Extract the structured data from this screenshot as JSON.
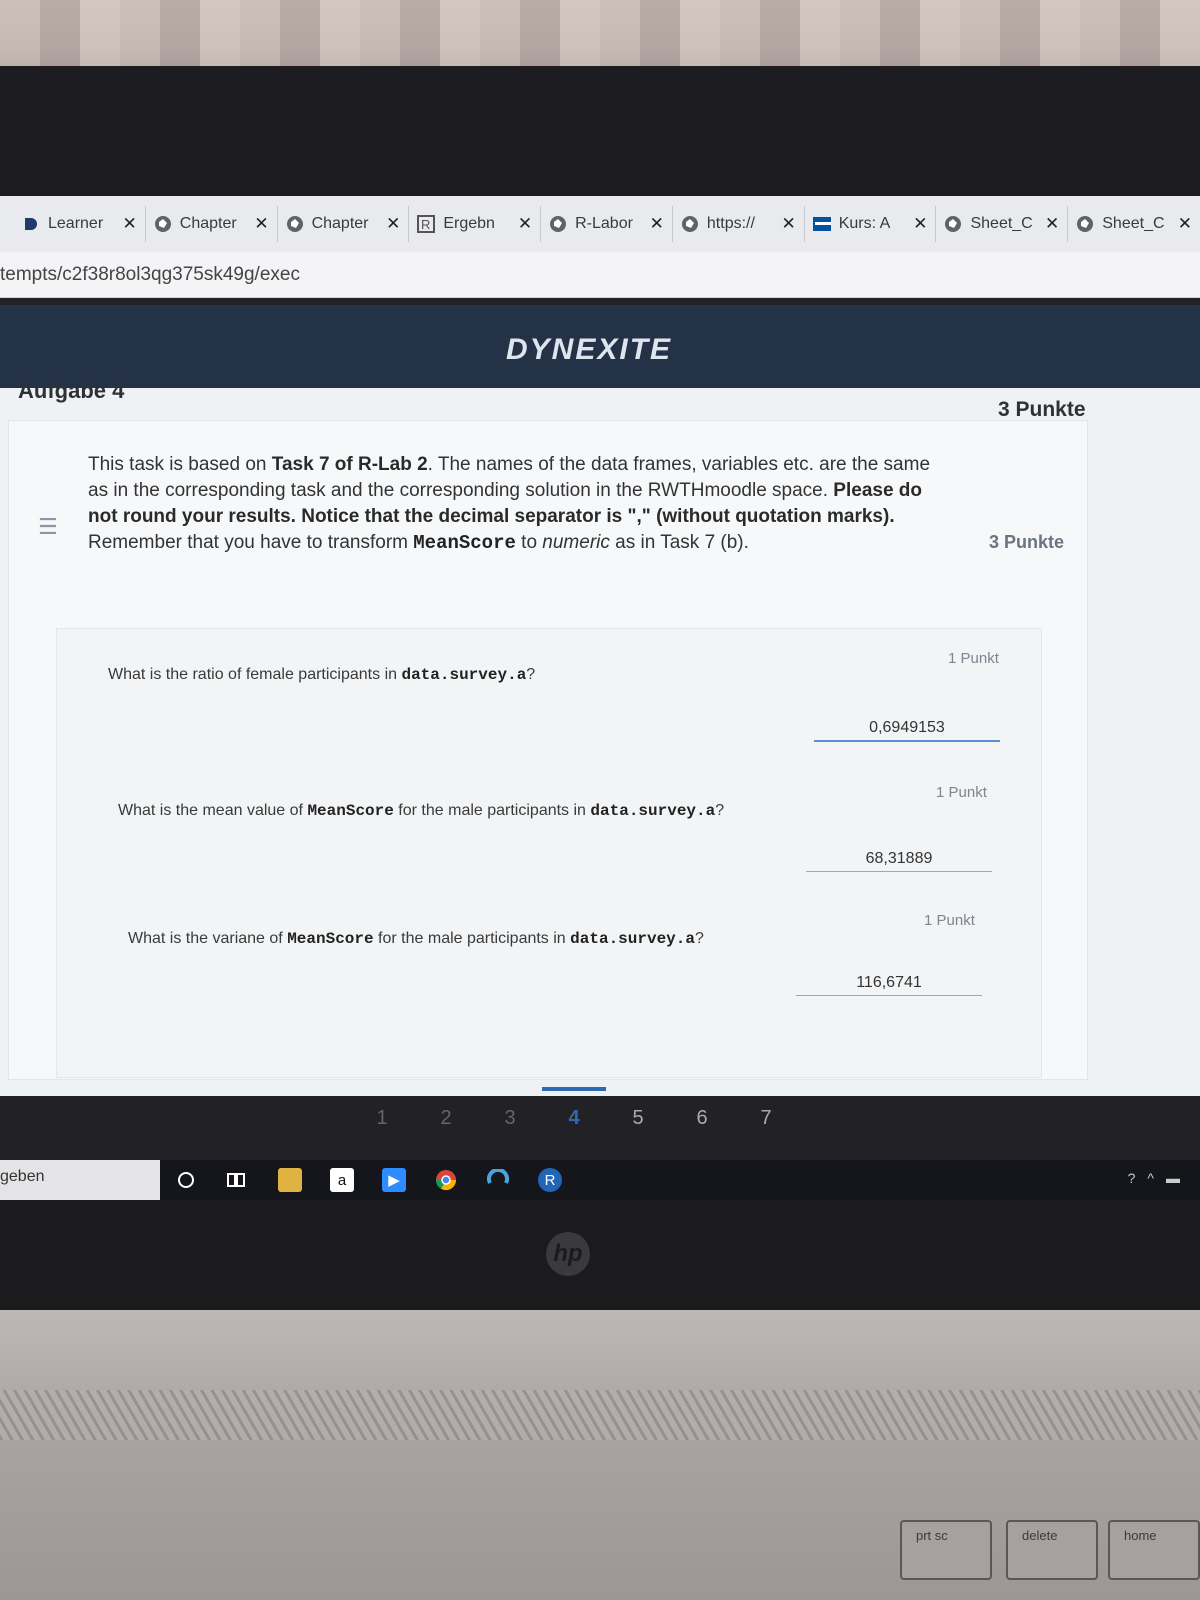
{
  "browser": {
    "tabs": [
      {
        "title": "Learner",
        "icon": "dynexite-icon"
      },
      {
        "title": "Chapter",
        "icon": "globe-icon"
      },
      {
        "title": "Chapter",
        "icon": "globe-icon"
      },
      {
        "title": "Ergebn",
        "icon": "r-icon"
      },
      {
        "title": "R-Labor",
        "icon": "globe-icon"
      },
      {
        "title": "https://",
        "icon": "globe-icon"
      },
      {
        "title": "Kurs: A",
        "icon": "rwth-icon"
      },
      {
        "title": "Sheet_C",
        "icon": "globe-icon"
      },
      {
        "title": "Sheet_C",
        "icon": "globe-icon"
      }
    ],
    "tab_close": "✕",
    "url": "tempts/c2f38r8ol3qg375sk49g/exec"
  },
  "app": {
    "brand": "DYNEXITE"
  },
  "task": {
    "title": "Aufgabe 4",
    "points": "3 Punkte",
    "intro_points": "3 Punkte",
    "intro": {
      "p1": "This task is based on ",
      "p1_bold": "Task 7 of R-Lab 2",
      "p2": ". The names of the data frames, variables etc. are the same as in the corresponding task and the corresponding solution in the RWTHmoodle space. ",
      "p2_bold": "Please do not round your results. Notice that the decimal separator is \",\" (without quotation marks).",
      "p3": " Remember that you have to transform ",
      "p3_code": "MeanScore",
      "p4": " to ",
      "p4_em": "numeric",
      "p5": " as in Task 7 (b)."
    },
    "questions": [
      {
        "pre": "What is the ratio of female participants in ",
        "code": "data.survey.a",
        "post": "?",
        "points": "1 Punkt",
        "answer": "0,6949153"
      },
      {
        "pre": "What is the mean value of ",
        "code1": "MeanScore",
        "mid": " for the male participants in ",
        "code": "data.survey.a",
        "post": "?",
        "points": "1 Punkt",
        "answer": "68,31889"
      },
      {
        "pre": "What is the variane of ",
        "code1": "MeanScore",
        "mid": " for the male participants in ",
        "code": "data.survey.a",
        "post": "?",
        "points": "1 Punkt",
        "answer": "116,6741"
      }
    ]
  },
  "pager": {
    "pages": [
      "1",
      "2",
      "3",
      "4",
      "5",
      "6",
      "7"
    ],
    "active": "4"
  },
  "taskbar": {
    "left_text": "geben",
    "colors": {
      "chrome": "#f2b705",
      "folder": "#e0b341",
      "amazon": "#ffffff",
      "zoom": "#2d8cff",
      "r": "#2165b6"
    }
  },
  "laptop": {
    "logo": "hp",
    "keys": [
      "prt sc",
      "delete",
      "home"
    ]
  }
}
